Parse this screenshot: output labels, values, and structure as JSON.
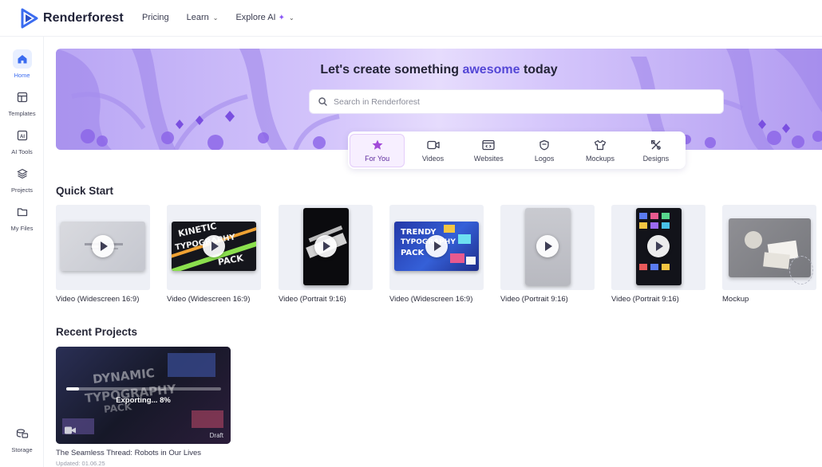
{
  "brand": {
    "name": "Renderforest",
    "logo_icon": "renderforest-play-icon",
    "accent": "#3b6cf0"
  },
  "nav": {
    "items": [
      {
        "label": "Pricing",
        "has_chevron": false
      },
      {
        "label": "Learn",
        "has_chevron": true
      },
      {
        "label": "Explore AI",
        "has_chevron": true,
        "sparkle": true
      }
    ]
  },
  "sidebar": {
    "items": [
      {
        "label": "Home",
        "icon": "home-icon",
        "active": true
      },
      {
        "label": "Templates",
        "icon": "templates-icon",
        "active": false
      },
      {
        "label": "AI Tools",
        "icon": "ai-tools-icon",
        "active": false
      },
      {
        "label": "Projects",
        "icon": "projects-icon",
        "active": false
      },
      {
        "label": "My Files",
        "icon": "folder-icon",
        "active": false
      }
    ],
    "bottom": {
      "label": "Storage",
      "icon": "storage-icon"
    }
  },
  "hero": {
    "title_before": "Let's create something ",
    "title_accent": "awesome",
    "title_after": " today",
    "search_placeholder": "Search in Renderforest"
  },
  "categories": [
    {
      "label": "For You",
      "icon": "star-icon",
      "active": true
    },
    {
      "label": "Videos",
      "icon": "video-camera-icon",
      "active": false
    },
    {
      "label": "Websites",
      "icon": "website-icon",
      "active": false
    },
    {
      "label": "Logos",
      "icon": "logo-icon",
      "active": false
    },
    {
      "label": "Mockups",
      "icon": "tshirt-icon",
      "active": false
    },
    {
      "label": "Designs",
      "icon": "designs-icon",
      "active": false
    }
  ],
  "quick_start": {
    "title": "Quick Start",
    "items": [
      {
        "label": "Video (Widescreen 16:9)"
      },
      {
        "label": "Video (Widescreen 16:9)",
        "thumb_text": [
          "KINETIC",
          "TYPOGRAPHY",
          "PACK"
        ]
      },
      {
        "label": "Video (Portrait 9:16)"
      },
      {
        "label": "Video (Widescreen 16:9)",
        "thumb_text": [
          "TRENDY",
          "TYPOGRAPHY",
          "PACK"
        ]
      },
      {
        "label": "Video (Portrait 9:16)"
      },
      {
        "label": "Video (Portrait 9:16)"
      },
      {
        "label": "Mockup"
      }
    ]
  },
  "recent_projects": {
    "title": "Recent Projects",
    "items": [
      {
        "title": "The Seamless Thread: Robots in Our Lives",
        "updated": "Updated: 01.06.25",
        "status": "Exporting... 8%",
        "progress": 0.08,
        "badge": "Draft",
        "thumb_text": [
          "DYNAMIC",
          "TYPOGRAPHY",
          "PACK"
        ]
      }
    ]
  }
}
